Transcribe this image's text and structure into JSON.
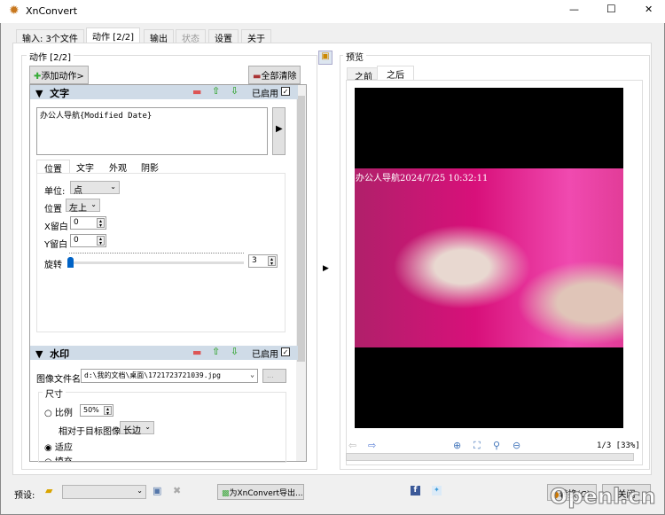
{
  "window": {
    "title": "XnConvert",
    "min": "—",
    "max": "☐",
    "close": "✕"
  },
  "tabs": [
    {
      "label": "输入: 3个文件"
    },
    {
      "label": "动作 [2/2]"
    },
    {
      "label": "输出"
    },
    {
      "label": "状态"
    },
    {
      "label": "设置"
    },
    {
      "label": "关于"
    }
  ],
  "actions": {
    "group_label": "动作 [2/2]",
    "add_label": "添加动作>",
    "clear_label": "全部清除",
    "text_action": {
      "title": "文字",
      "enabled_label": "已启用",
      "enabled": true,
      "text_value": "办公人导航{Modified Date}",
      "subtabs": [
        "位置",
        "文字",
        "外观",
        "阴影"
      ],
      "unit_label": "单位:",
      "unit_value": "点",
      "position_label": "位置",
      "position_value": "左上",
      "xmargin_label": "X留白",
      "xmargin_value": "0",
      "ymargin_label": "Y留白",
      "ymargin_value": "0",
      "rotate_label": "旋转",
      "rotate_value": "3"
    },
    "watermark_action": {
      "title": "水印",
      "enabled_label": "已启用",
      "enabled": true,
      "file_label": "图像文件名",
      "file_value": "d:\\我的文档\\桌面\\1721723721039.jpg",
      "browse_label": "...",
      "size_label": "尺寸",
      "ratio_label": "比例",
      "ratio_value": "50%",
      "relative_label": "相对于目标图像",
      "relative_value": "长边",
      "fit_label": "适应",
      "fill_label": "填充",
      "selected": "适应"
    }
  },
  "preview": {
    "group_label": "预览",
    "tabs": [
      {
        "label": "之前"
      },
      {
        "label": "之后"
      }
    ],
    "overlay_text": "办公人导航2024/7/25 10:32:11",
    "page_info": "1/3 [33%]"
  },
  "bottom": {
    "preset_label": "预设:",
    "preset_value": "",
    "export_label": "为XnConvert导出...",
    "convert_label": "转换(C)",
    "close_label": "关闭",
    "watermark_logo": "Openl.cn"
  }
}
